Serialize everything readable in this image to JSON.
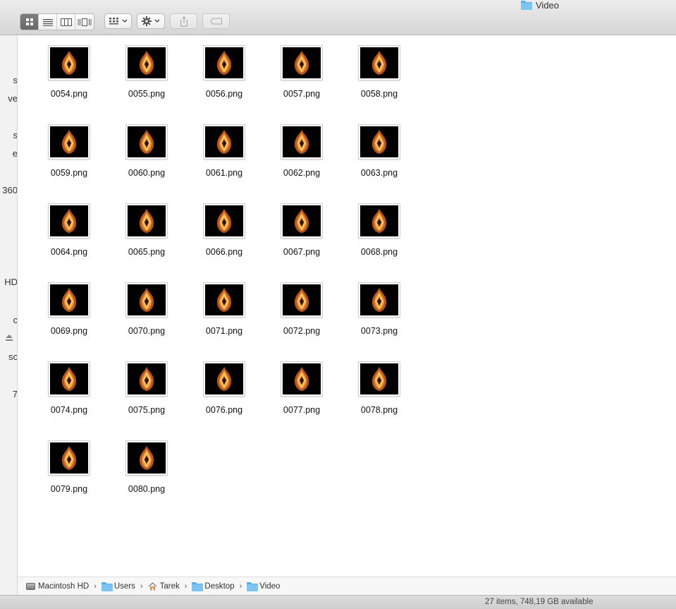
{
  "window": {
    "title": "Video"
  },
  "toolbar": {
    "view_modes": [
      "icon-view",
      "list-view",
      "column-view",
      "cover-flow-view"
    ],
    "active_view": "icon-view",
    "arrange_icon": "arrange-grid-icon",
    "action_icon": "gear-icon",
    "share_icon": "share-icon",
    "tag_icon": "tag-icon"
  },
  "sidebar": {
    "fragments": [
      "s",
      "ve",
      "s",
      "e",
      "360",
      "HD",
      "c",
      "sc",
      "7"
    ]
  },
  "files": [
    "0054.png",
    "0055.png",
    "0056.png",
    "0057.png",
    "0058.png",
    "0059.png",
    "0060.png",
    "0061.png",
    "0062.png",
    "0063.png",
    "0064.png",
    "0065.png",
    "0066.png",
    "0067.png",
    "0068.png",
    "0069.png",
    "0070.png",
    "0071.png",
    "0072.png",
    "0073.png",
    "0074.png",
    "0075.png",
    "0076.png",
    "0077.png",
    "0078.png",
    "0079.png",
    "0080.png"
  ],
  "pathbar": {
    "crumbs": [
      {
        "label": "Macintosh HD",
        "icon": "hard-drive-icon"
      },
      {
        "label": "Users",
        "icon": "folder-icon"
      },
      {
        "label": "Tarek",
        "icon": "home-icon"
      },
      {
        "label": "Desktop",
        "icon": "folder-icon"
      },
      {
        "label": "Video",
        "icon": "folder-icon"
      }
    ],
    "separator": "›"
  },
  "status": {
    "text": "27 items, 748,19 GB available"
  },
  "colors": {
    "folder": "#7cc4f2",
    "flame": "#f0902a",
    "thumb_bg": "#000000"
  }
}
